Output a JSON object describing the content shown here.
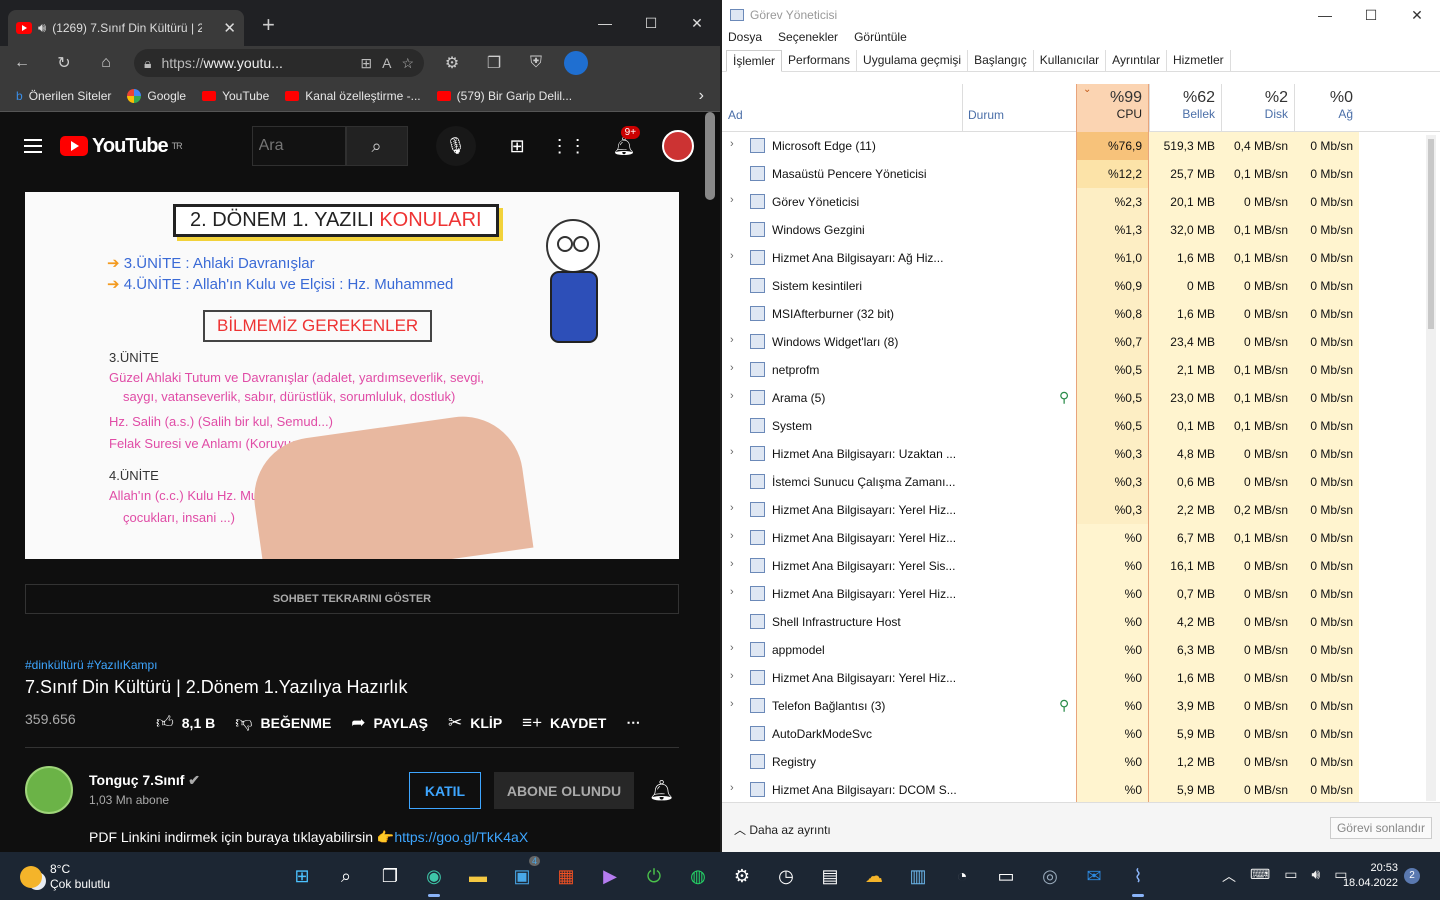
{
  "browser": {
    "tab_title": "(1269) 7.Sınıf Din Kültürü | 2",
    "url_prefix": "https://",
    "url_host": "www.youtu...",
    "bookmarks": [
      "Önerilen Siteler",
      "Google",
      "YouTube",
      "Kanal özelleştirme -...",
      "(579) Bir Garip Delil..."
    ]
  },
  "youtube": {
    "logo": "YouTube",
    "logo_region": "TR",
    "search_placeholder": "Ara",
    "notif_count": "9+",
    "video_board": {
      "title_a": "2. DÖNEM 1. YAZILI ",
      "title_b": "KONULARI",
      "line1": "3.ÜNİTE : Ahlaki Davranışlar",
      "line2": "4.ÜNİTE : Allah'ın Kulu ve Elçisi : Hz. Muhammed",
      "box": "BİLMEMİZ GEREKENLER",
      "h3": "3.ÜNİTE",
      "b1": "Güzel Ahlaki Tutum ve Davranışlar (adalet, yardımseverlik, sevgi,",
      "b1b": "saygı, vatanseverlik, sabır, dürüstlük, sorumluluk, dostluk)",
      "b2": "Hz. Salih (a.s.) (Salih bir kul, Semud...)",
      "b3": "Felak Suresi ve Anlamı (Koruyucu ... surelerden)",
      "h4": "4.ÜNİTE",
      "b4": "Allah'ın (c.c.) Kulu Hz. Muhammed ... eşi ve",
      "b4b": "çocukları, insani ...)"
    },
    "chat_replay": "SOHBET TEKRARINI GÖSTER",
    "tags": "#dinkültürü #YazılıKampı",
    "title": "7.Sınıf Din Kültürü | 2.Dönem 1.Yazılıya Hazırlık",
    "views": "359.656",
    "likes": "8,1 B",
    "dislike": "BEĞENME",
    "share": "PAYLAŞ",
    "clip": "KLİP",
    "save": "KAYDET",
    "channel": "Tonguç 7.Sınıf",
    "subs": "1,03 Mn abone",
    "join": "KATIL",
    "subscribed": "ABONE OLUNDU",
    "desc_text": "PDF Linkini indirmek için buraya tıklayabilirsin 👉",
    "desc_link": "https://goo.gl/TkK4aX"
  },
  "taskmgr": {
    "title": "Görev Yöneticisi",
    "menu": [
      "Dosya",
      "Seçenekler",
      "Görüntüle"
    ],
    "tabs": [
      "İşlemler",
      "Performans",
      "Uygulama geçmişi",
      "Başlangıç",
      "Kullanıcılar",
      "Ayrıntılar",
      "Hizmetler"
    ],
    "col_name": "Ad",
    "col_status": "Durum",
    "cpu_pct": "%99",
    "cpu_lbl": "CPU",
    "mem_pct": "%62",
    "mem_lbl": "Bellek",
    "disk_pct": "%2",
    "disk_lbl": "Disk",
    "net_pct": "%0",
    "net_lbl": "Ağ",
    "rows": [
      {
        "name": "Microsoft Edge (11)",
        "cpu": "%76,9",
        "mem": "519,3 MB",
        "disk": "0,4 MB/sn",
        "net": "0 Mb/sn"
      },
      {
        "name": "Masaüstü Pencere Yöneticisi",
        "cpu": "%12,2",
        "mem": "25,7 MB",
        "disk": "0,1 MB/sn",
        "net": "0 Mb/sn"
      },
      {
        "name": "Görev Yöneticisi",
        "cpu": "%2,3",
        "mem": "20,1 MB",
        "disk": "0 MB/sn",
        "net": "0 Mb/sn"
      },
      {
        "name": "Windows Gezgini",
        "cpu": "%1,3",
        "mem": "32,0 MB",
        "disk": "0,1 MB/sn",
        "net": "0 Mb/sn"
      },
      {
        "name": "Hizmet Ana Bilgisayarı: Ağ Hiz...",
        "cpu": "%1,0",
        "mem": "1,6 MB",
        "disk": "0,1 MB/sn",
        "net": "0 Mb/sn"
      },
      {
        "name": "Sistem kesintileri",
        "cpu": "%0,9",
        "mem": "0 MB",
        "disk": "0 MB/sn",
        "net": "0 Mb/sn"
      },
      {
        "name": "MSIAfterburner (32 bit)",
        "cpu": "%0,8",
        "mem": "1,6 MB",
        "disk": "0 MB/sn",
        "net": "0 Mb/sn"
      },
      {
        "name": "Windows Widget'ları (8)",
        "cpu": "%0,7",
        "mem": "23,4 MB",
        "disk": "0 MB/sn",
        "net": "0 Mb/sn"
      },
      {
        "name": "netprofm",
        "cpu": "%0,5",
        "mem": "2,1 MB",
        "disk": "0,1 MB/sn",
        "net": "0 Mb/sn"
      },
      {
        "name": "Arama (5)",
        "cpu": "%0,5",
        "mem": "23,0 MB",
        "disk": "0,1 MB/sn",
        "net": "0 Mb/sn"
      },
      {
        "name": "System",
        "cpu": "%0,5",
        "mem": "0,1 MB",
        "disk": "0,1 MB/sn",
        "net": "0 Mb/sn"
      },
      {
        "name": "Hizmet Ana Bilgisayarı: Uzaktan ...",
        "cpu": "%0,3",
        "mem": "4,8 MB",
        "disk": "0 MB/sn",
        "net": "0 Mb/sn"
      },
      {
        "name": "İstemci Sunucu Çalışma Zamanı...",
        "cpu": "%0,3",
        "mem": "0,6 MB",
        "disk": "0 MB/sn",
        "net": "0 Mb/sn"
      },
      {
        "name": "Hizmet Ana Bilgisayarı: Yerel Hiz...",
        "cpu": "%0,3",
        "mem": "2,2 MB",
        "disk": "0,2 MB/sn",
        "net": "0 Mb/sn"
      },
      {
        "name": "Hizmet Ana Bilgisayarı: Yerel Hiz...",
        "cpu": "%0",
        "mem": "6,7 MB",
        "disk": "0,1 MB/sn",
        "net": "0 Mb/sn"
      },
      {
        "name": "Hizmet Ana Bilgisayarı: Yerel Sis...",
        "cpu": "%0",
        "mem": "16,1 MB",
        "disk": "0 MB/sn",
        "net": "0 Mb/sn"
      },
      {
        "name": "Hizmet Ana Bilgisayarı: Yerel Hiz...",
        "cpu": "%0",
        "mem": "0,7 MB",
        "disk": "0 MB/sn",
        "net": "0 Mb/sn"
      },
      {
        "name": "Shell Infrastructure Host",
        "cpu": "%0",
        "mem": "4,2 MB",
        "disk": "0 MB/sn",
        "net": "0 Mb/sn"
      },
      {
        "name": "appmodel",
        "cpu": "%0",
        "mem": "6,3 MB",
        "disk": "0 MB/sn",
        "net": "0 Mb/sn"
      },
      {
        "name": "Hizmet Ana Bilgisayarı: Yerel Hiz...",
        "cpu": "%0",
        "mem": "1,6 MB",
        "disk": "0 MB/sn",
        "net": "0 Mb/sn"
      },
      {
        "name": "Telefon Bağlantısı (3)",
        "cpu": "%0",
        "mem": "3,9 MB",
        "disk": "0 MB/sn",
        "net": "0 Mb/sn"
      },
      {
        "name": "AutoDarkModeSvc",
        "cpu": "%0",
        "mem": "5,9 MB",
        "disk": "0 MB/sn",
        "net": "0 Mb/sn"
      },
      {
        "name": "Registry",
        "cpu": "%0",
        "mem": "1,2 MB",
        "disk": "0 MB/sn",
        "net": "0 Mb/sn"
      },
      {
        "name": "Hizmet Ana Bilgisayarı: DCOM S...",
        "cpu": "%0",
        "mem": "5,9 MB",
        "disk": "0 MB/sn",
        "net": "0 Mb/sn"
      }
    ],
    "fewer_details": "Daha az ayrıntı",
    "end_task": "Görevi sonlandır"
  },
  "taskbar": {
    "temp": "8°C",
    "weather": "Çok bulutlu",
    "store_badge": "4",
    "time": "20:53",
    "date": "18.04.2022",
    "notif": "2"
  }
}
